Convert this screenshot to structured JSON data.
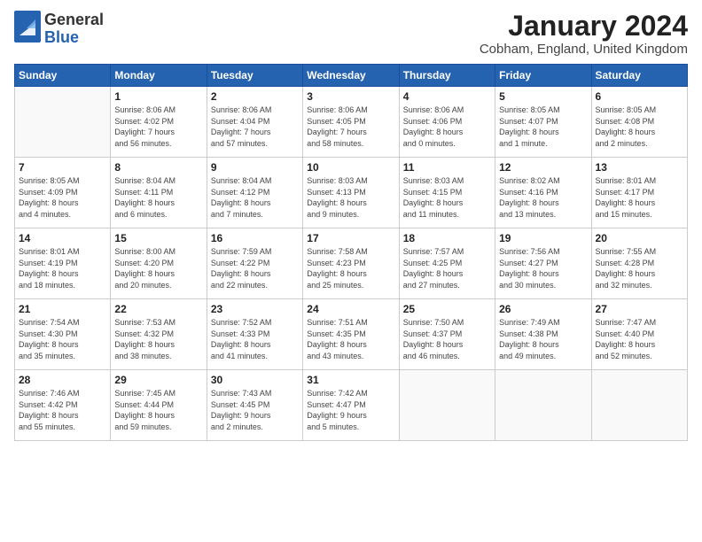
{
  "logo": {
    "general": "General",
    "blue": "Blue"
  },
  "header": {
    "month": "January 2024",
    "location": "Cobham, England, United Kingdom"
  },
  "weekdays": [
    "Sunday",
    "Monday",
    "Tuesday",
    "Wednesday",
    "Thursday",
    "Friday",
    "Saturday"
  ],
  "weeks": [
    [
      {
        "day": "",
        "info": ""
      },
      {
        "day": "1",
        "info": "Sunrise: 8:06 AM\nSunset: 4:02 PM\nDaylight: 7 hours\nand 56 minutes."
      },
      {
        "day": "2",
        "info": "Sunrise: 8:06 AM\nSunset: 4:04 PM\nDaylight: 7 hours\nand 57 minutes."
      },
      {
        "day": "3",
        "info": "Sunrise: 8:06 AM\nSunset: 4:05 PM\nDaylight: 7 hours\nand 58 minutes."
      },
      {
        "day": "4",
        "info": "Sunrise: 8:06 AM\nSunset: 4:06 PM\nDaylight: 8 hours\nand 0 minutes."
      },
      {
        "day": "5",
        "info": "Sunrise: 8:05 AM\nSunset: 4:07 PM\nDaylight: 8 hours\nand 1 minute."
      },
      {
        "day": "6",
        "info": "Sunrise: 8:05 AM\nSunset: 4:08 PM\nDaylight: 8 hours\nand 2 minutes."
      }
    ],
    [
      {
        "day": "7",
        "info": "Sunrise: 8:05 AM\nSunset: 4:09 PM\nDaylight: 8 hours\nand 4 minutes."
      },
      {
        "day": "8",
        "info": "Sunrise: 8:04 AM\nSunset: 4:11 PM\nDaylight: 8 hours\nand 6 minutes."
      },
      {
        "day": "9",
        "info": "Sunrise: 8:04 AM\nSunset: 4:12 PM\nDaylight: 8 hours\nand 7 minutes."
      },
      {
        "day": "10",
        "info": "Sunrise: 8:03 AM\nSunset: 4:13 PM\nDaylight: 8 hours\nand 9 minutes."
      },
      {
        "day": "11",
        "info": "Sunrise: 8:03 AM\nSunset: 4:15 PM\nDaylight: 8 hours\nand 11 minutes."
      },
      {
        "day": "12",
        "info": "Sunrise: 8:02 AM\nSunset: 4:16 PM\nDaylight: 8 hours\nand 13 minutes."
      },
      {
        "day": "13",
        "info": "Sunrise: 8:01 AM\nSunset: 4:17 PM\nDaylight: 8 hours\nand 15 minutes."
      }
    ],
    [
      {
        "day": "14",
        "info": "Sunrise: 8:01 AM\nSunset: 4:19 PM\nDaylight: 8 hours\nand 18 minutes."
      },
      {
        "day": "15",
        "info": "Sunrise: 8:00 AM\nSunset: 4:20 PM\nDaylight: 8 hours\nand 20 minutes."
      },
      {
        "day": "16",
        "info": "Sunrise: 7:59 AM\nSunset: 4:22 PM\nDaylight: 8 hours\nand 22 minutes."
      },
      {
        "day": "17",
        "info": "Sunrise: 7:58 AM\nSunset: 4:23 PM\nDaylight: 8 hours\nand 25 minutes."
      },
      {
        "day": "18",
        "info": "Sunrise: 7:57 AM\nSunset: 4:25 PM\nDaylight: 8 hours\nand 27 minutes."
      },
      {
        "day": "19",
        "info": "Sunrise: 7:56 AM\nSunset: 4:27 PM\nDaylight: 8 hours\nand 30 minutes."
      },
      {
        "day": "20",
        "info": "Sunrise: 7:55 AM\nSunset: 4:28 PM\nDaylight: 8 hours\nand 32 minutes."
      }
    ],
    [
      {
        "day": "21",
        "info": "Sunrise: 7:54 AM\nSunset: 4:30 PM\nDaylight: 8 hours\nand 35 minutes."
      },
      {
        "day": "22",
        "info": "Sunrise: 7:53 AM\nSunset: 4:32 PM\nDaylight: 8 hours\nand 38 minutes."
      },
      {
        "day": "23",
        "info": "Sunrise: 7:52 AM\nSunset: 4:33 PM\nDaylight: 8 hours\nand 41 minutes."
      },
      {
        "day": "24",
        "info": "Sunrise: 7:51 AM\nSunset: 4:35 PM\nDaylight: 8 hours\nand 43 minutes."
      },
      {
        "day": "25",
        "info": "Sunrise: 7:50 AM\nSunset: 4:37 PM\nDaylight: 8 hours\nand 46 minutes."
      },
      {
        "day": "26",
        "info": "Sunrise: 7:49 AM\nSunset: 4:38 PM\nDaylight: 8 hours\nand 49 minutes."
      },
      {
        "day": "27",
        "info": "Sunrise: 7:47 AM\nSunset: 4:40 PM\nDaylight: 8 hours\nand 52 minutes."
      }
    ],
    [
      {
        "day": "28",
        "info": "Sunrise: 7:46 AM\nSunset: 4:42 PM\nDaylight: 8 hours\nand 55 minutes."
      },
      {
        "day": "29",
        "info": "Sunrise: 7:45 AM\nSunset: 4:44 PM\nDaylight: 8 hours\nand 59 minutes."
      },
      {
        "day": "30",
        "info": "Sunrise: 7:43 AM\nSunset: 4:45 PM\nDaylight: 9 hours\nand 2 minutes."
      },
      {
        "day": "31",
        "info": "Sunrise: 7:42 AM\nSunset: 4:47 PM\nDaylight: 9 hours\nand 5 minutes."
      },
      {
        "day": "",
        "info": ""
      },
      {
        "day": "",
        "info": ""
      },
      {
        "day": "",
        "info": ""
      }
    ]
  ]
}
